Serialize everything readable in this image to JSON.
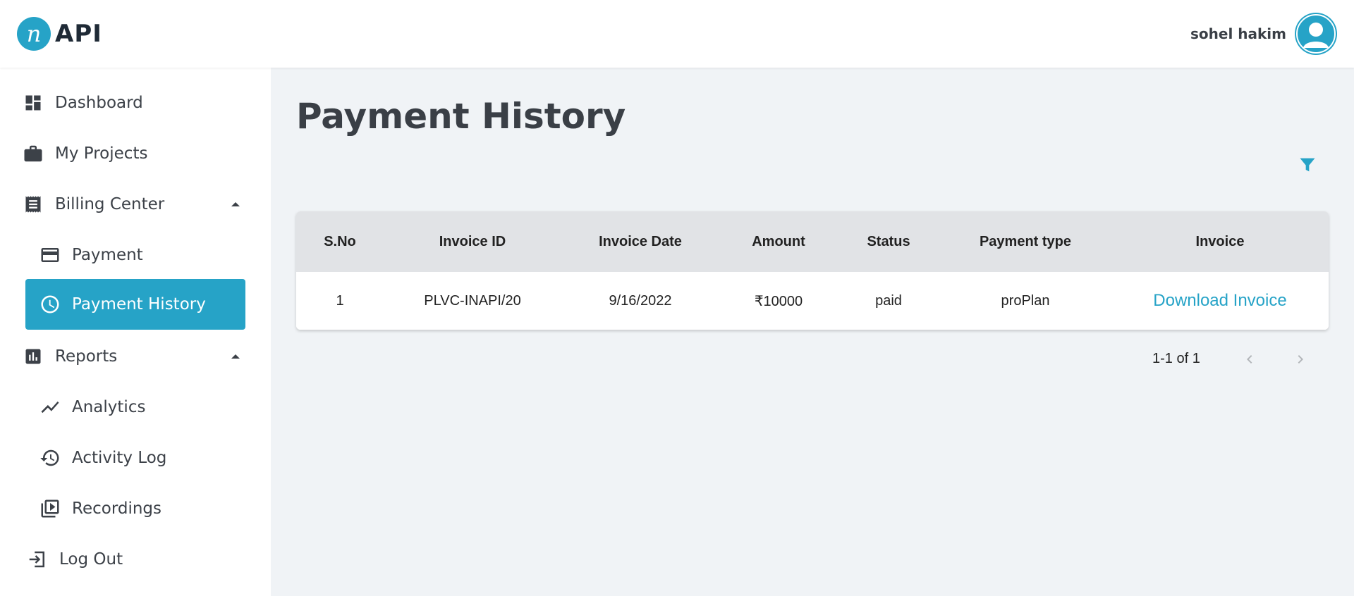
{
  "header": {
    "logo_text": "API",
    "logo_mark": "n",
    "user_name": "sohel hakim"
  },
  "sidebar": {
    "items": [
      {
        "label": "Dashboard",
        "icon": "dashboard-icon"
      },
      {
        "label": "My Projects",
        "icon": "briefcase-icon"
      },
      {
        "label": "Billing Center",
        "icon": "receipt-icon",
        "expanded": true
      },
      {
        "label": "Payment",
        "icon": "credit-card-icon"
      },
      {
        "label": "Payment History",
        "icon": "clock-icon",
        "active": true
      },
      {
        "label": "Reports",
        "icon": "bar-chart-icon",
        "expanded": true
      },
      {
        "label": "Analytics",
        "icon": "trending-line-icon"
      },
      {
        "label": "Activity Log",
        "icon": "history-icon"
      },
      {
        "label": "Recordings",
        "icon": "video-library-icon"
      },
      {
        "label": "Log Out",
        "icon": "logout-icon"
      }
    ]
  },
  "main": {
    "title": "Payment History",
    "filter_icon": "filter-icon",
    "table": {
      "columns": [
        "S.No",
        "Invoice ID",
        "Invoice Date",
        "Amount",
        "Status",
        "Payment type",
        "Invoice"
      ],
      "rows": [
        [
          "1",
          "PLVC-INAPI/20",
          "9/16/2022",
          "₹10000",
          "paid",
          "proPlan",
          "Download Invoice"
        ]
      ]
    },
    "pagination": {
      "range_text": "1-1 of 1"
    }
  },
  "colors": {
    "accent": "#26a3c7",
    "background": "#f0f3f6",
    "table_header": "#e1e3e6"
  }
}
